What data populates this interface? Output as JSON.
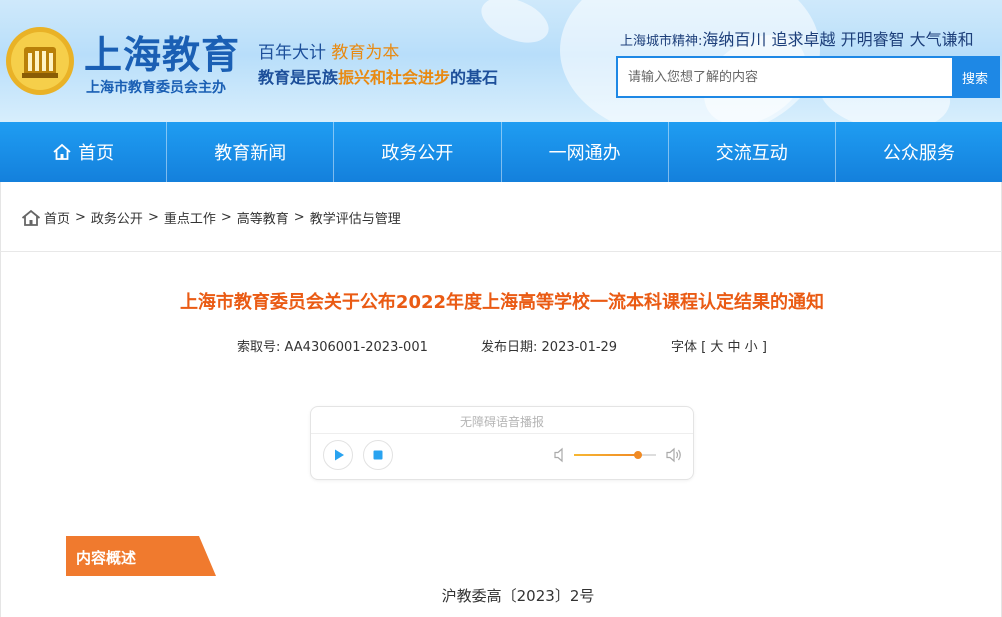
{
  "header": {
    "site_title": "上海教育",
    "site_subtitle": "上海市教育委员会主办",
    "slogan1_part1": "百年大计 ",
    "slogan1_part2": "教育为本",
    "slogan2_part1": "教育是民族",
    "slogan2_part2": "振兴和社会进步",
    "slogan2_part3": "的基石",
    "spirit_label": "上海城市精神:",
    "spirit_text": "海纳百川 追求卓越 开明睿智 大气谦和",
    "search_placeholder": "请输入您想了解的内容",
    "search_button": "搜索"
  },
  "nav": {
    "items": [
      "首页",
      "教育新闻",
      "政务公开",
      "一网通办",
      "交流互动",
      "公众服务"
    ]
  },
  "breadcrumb": {
    "items": [
      "首页",
      "政务公开",
      "重点工作",
      "高等教育",
      "教学评估与管理"
    ],
    "separator": ">"
  },
  "article": {
    "title": "上海市教育委员会关于公布2022年度上海高等学校一流本科课程认定结果的通知",
    "index_label": "索取号:",
    "index_value": "AA4306001-2023-001",
    "date_label": "发布日期:",
    "date_value": "2023-01-29",
    "font_label": "字体 [",
    "font_large": "大",
    "font_medium": "中",
    "font_small": "小",
    "font_close": "]",
    "section_label": "内容概述",
    "doc_number": "沪教委高〔2023〕2号"
  },
  "player": {
    "label": "无障碍语音播报",
    "volume_level": 0.78
  },
  "colors": {
    "nav_blue": "#1480dc",
    "title_orange": "#ea5b14",
    "tag_orange": "#f07a2e"
  }
}
